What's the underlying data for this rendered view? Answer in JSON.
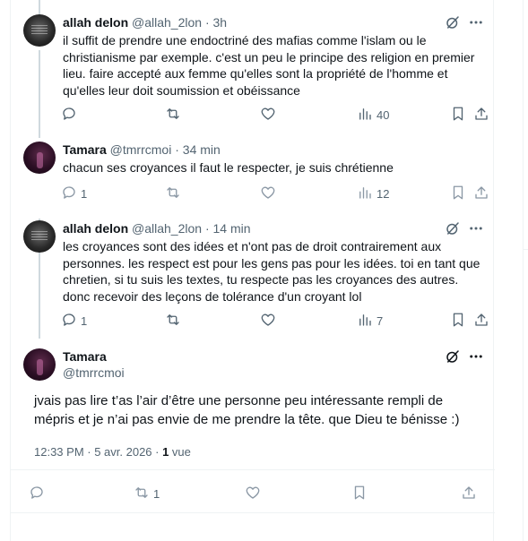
{
  "tweets": [
    {
      "author": "allah delon",
      "handle": "@allah_2lon",
      "sep": "·",
      "time": "3h",
      "text": "il suffit de prendre une endoctriné des mafias comme l'islam ou le christianisme par exemple. c'est un peu le principe des religion en premier lieu. faire accepté aux femme qu'elles sont la propriété de l'homme et qu'elles leur doit soumission et obéissance",
      "replies": "",
      "retweets": "",
      "views": "40"
    },
    {
      "author": "Tamara",
      "handle": "@tmrrcmoi",
      "sep": "·",
      "time": "34 min",
      "text": "chacun ses croyances il faut le respecter, je suis chrétienne",
      "replies": "1",
      "retweets": "",
      "views": "12"
    },
    {
      "author": "allah delon",
      "handle": "@allah_2lon",
      "sep": "·",
      "time": "14 min",
      "text": "les croyances sont des idées et n'ont pas de droit contrairement aux personnes. les respect est pour les gens pas pour les idées. toi en tant que chretien, si tu suis les textes, tu respecte pas les croyances des autres. donc recevoir des leçons de tolérance d'un croyant lol",
      "replies": "1",
      "retweets": "",
      "views": "7"
    }
  ],
  "main_tweet": {
    "author": "Tamara",
    "handle": "@tmrrcmoi",
    "text": "jvais pas lire t’as l’air d’être une personne peu intéressante rempli de mépris et je n’ai pas envie de me prendre la tête. que Dieu te bénisse :)",
    "timestamp": "12:33 PM · 5 avr. 2026 · ",
    "views_count": "1",
    "views_label": " vue",
    "retweets": "1"
  },
  "icons": [
    "grok-icon",
    "more-icon",
    "reply-icon",
    "retweet-icon",
    "like-icon",
    "views-icon",
    "bookmark-icon",
    "share-icon"
  ],
  "colors": {
    "text": "#0f1419",
    "muted": "#536471",
    "border": "#eff3f4",
    "thread": "#cfd9de"
  }
}
